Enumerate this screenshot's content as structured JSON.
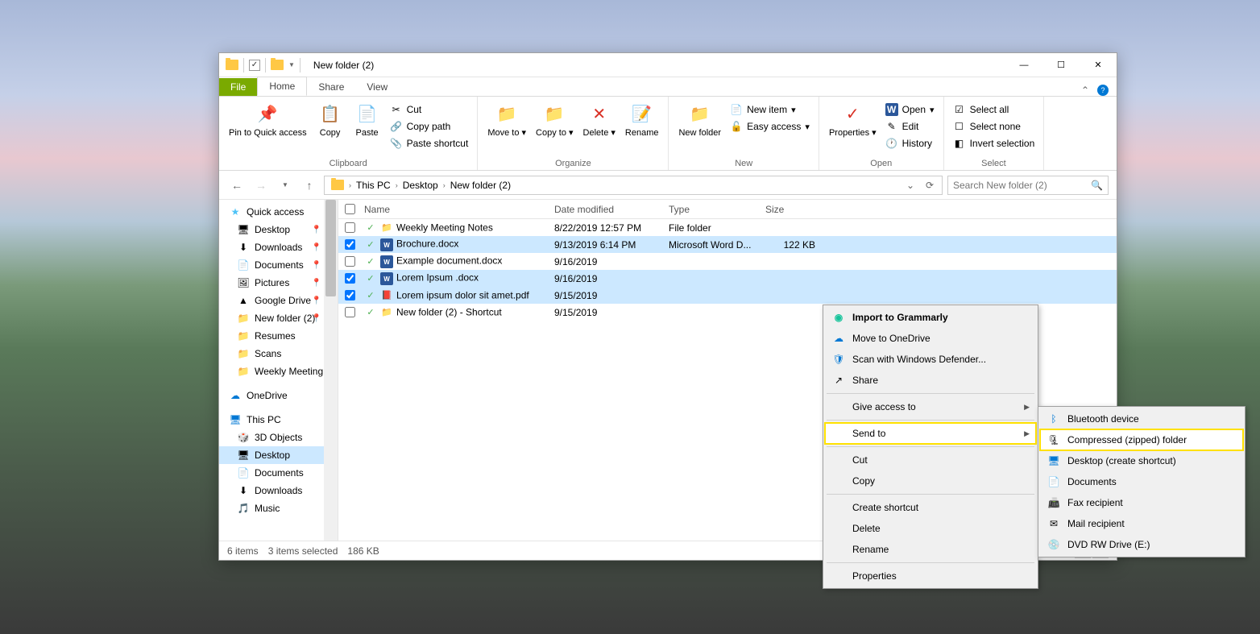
{
  "window": {
    "title": "New folder (2)",
    "tabs": {
      "file": "File",
      "home": "Home",
      "share": "Share",
      "view": "View"
    }
  },
  "ribbon": {
    "clipboard": {
      "label": "Clipboard",
      "pin": "Pin to Quick access",
      "copy": "Copy",
      "paste": "Paste",
      "cut": "Cut",
      "copypath": "Copy path",
      "pasteshortcut": "Paste shortcut"
    },
    "organize": {
      "label": "Organize",
      "moveto": "Move to",
      "copyto": "Copy to",
      "delete": "Delete",
      "rename": "Rename"
    },
    "new": {
      "label": "New",
      "newfolder": "New folder",
      "newitem": "New item",
      "easyaccess": "Easy access"
    },
    "open": {
      "label": "Open",
      "properties": "Properties",
      "open": "Open",
      "edit": "Edit",
      "history": "History"
    },
    "select": {
      "label": "Select",
      "selectall": "Select all",
      "selectnone": "Select none",
      "invert": "Invert selection"
    }
  },
  "breadcrumb": [
    "This PC",
    "Desktop",
    "New folder (2)"
  ],
  "search": {
    "placeholder": "Search New folder (2)"
  },
  "columns": {
    "name": "Name",
    "date": "Date modified",
    "type": "Type",
    "size": "Size"
  },
  "sidebar": {
    "quickaccess": "Quick access",
    "items1": [
      "Desktop",
      "Downloads",
      "Documents",
      "Pictures",
      "Google Drive",
      "New folder (2)",
      "Resumes",
      "Scans",
      "Weekly Meeting"
    ],
    "onedrive": "OneDrive",
    "thispc": "This PC",
    "items2": [
      "3D Objects",
      "Desktop",
      "Documents",
      "Downloads",
      "Music"
    ]
  },
  "files": [
    {
      "name": "Weekly Meeting Notes",
      "date": "8/22/2019 12:57 PM",
      "type": "File folder",
      "size": "",
      "sel": false,
      "icon": "folder"
    },
    {
      "name": "Brochure.docx",
      "date": "9/13/2019 6:14 PM",
      "type": "Microsoft Word D...",
      "size": "122 KB",
      "sel": true,
      "icon": "word"
    },
    {
      "name": "Example document.docx",
      "date": "9/16/2019",
      "type": "",
      "size": "",
      "sel": false,
      "icon": "word"
    },
    {
      "name": "Lorem Ipsum .docx",
      "date": "9/16/2019",
      "type": "",
      "size": "",
      "sel": true,
      "icon": "word"
    },
    {
      "name": "Lorem ipsum dolor sit amet.pdf",
      "date": "9/15/2019",
      "type": "",
      "size": "",
      "sel": true,
      "icon": "pdf"
    },
    {
      "name": "New folder (2) - Shortcut",
      "date": "9/15/2019",
      "type": "",
      "size": "",
      "sel": false,
      "icon": "folder"
    }
  ],
  "status": {
    "count": "6 items",
    "selected": "3 items selected",
    "size": "186 KB"
  },
  "ctx1": {
    "grammarly": "Import to Grammarly",
    "onedrive": "Move to OneDrive",
    "defender": "Scan with Windows Defender...",
    "share": "Share",
    "giveaccess": "Give access to",
    "sendto": "Send to",
    "cut": "Cut",
    "copy": "Copy",
    "shortcut": "Create shortcut",
    "delete": "Delete",
    "rename": "Rename",
    "properties": "Properties"
  },
  "ctx2": {
    "bluetooth": "Bluetooth device",
    "zip": "Compressed (zipped) folder",
    "desktop": "Desktop (create shortcut)",
    "documents": "Documents",
    "fax": "Fax recipient",
    "mail": "Mail recipient",
    "dvd": "DVD RW Drive (E:)"
  }
}
